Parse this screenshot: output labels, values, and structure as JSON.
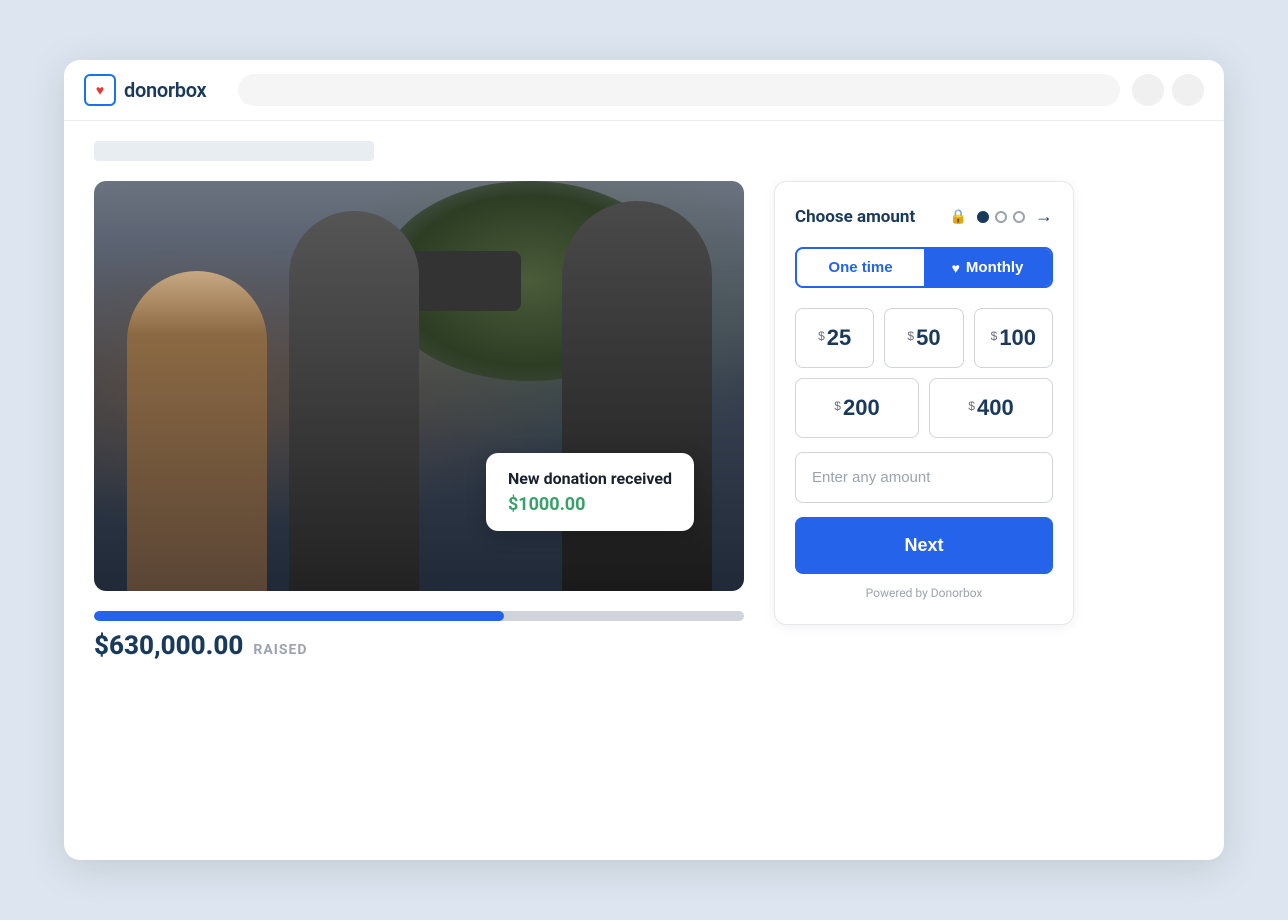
{
  "browser": {
    "logo_text": "donorbox",
    "url_placeholder": ""
  },
  "campaign": {
    "raised_amount": "$630,000.00",
    "raised_label": "RAISED",
    "progress_percent": 63,
    "notification": {
      "title": "New donation received",
      "amount": "$1000.00"
    }
  },
  "donation_panel": {
    "title": "Choose amount",
    "frequency": {
      "one_time_label": "One time",
      "monthly_label": "Monthly",
      "active": "monthly"
    },
    "amounts": [
      {
        "currency": "$",
        "value": "25"
      },
      {
        "currency": "$",
        "value": "50"
      },
      {
        "currency": "$",
        "value": "100"
      },
      {
        "currency": "$",
        "value": "200"
      },
      {
        "currency": "$",
        "value": "400"
      }
    ],
    "custom_amount_placeholder": "Enter any amount",
    "next_button_label": "Next",
    "powered_by": "Powered by Donorbox"
  }
}
